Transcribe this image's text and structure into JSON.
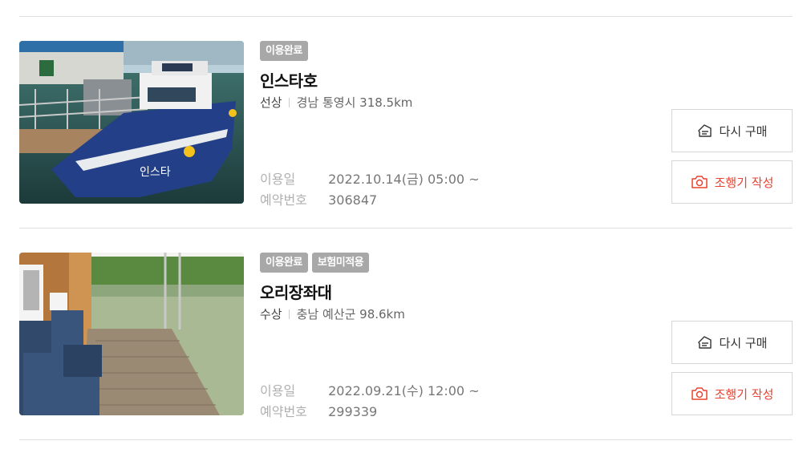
{
  "bookings": [
    {
      "badges": [
        "이용완료"
      ],
      "name": "인스타호",
      "category": "선상",
      "location": "경남 통영시 318.5km",
      "use_date_label": "이용일",
      "use_date": "2022.10.14(금) 05:00 ~",
      "booking_no_label": "예약번호",
      "booking_no": "306847",
      "rebuy_label": "다시 구매",
      "review_label": "조행기 작성"
    },
    {
      "badges": [
        "이용완료",
        "보험미적용"
      ],
      "name": "오리장좌대",
      "category": "수상",
      "location": "충남 예산군 98.6km",
      "use_date_label": "이용일",
      "use_date": "2022.09.21(수) 12:00 ~",
      "booking_no_label": "예약번호",
      "booking_no": "299339",
      "rebuy_label": "다시 구매",
      "review_label": "조행기 작성"
    }
  ],
  "boat_photo_text": "인스타",
  "colors": {
    "badge_bg": "#a8a8a8",
    "review_accent": "#e8432f",
    "divider": "#e1e1e1"
  }
}
